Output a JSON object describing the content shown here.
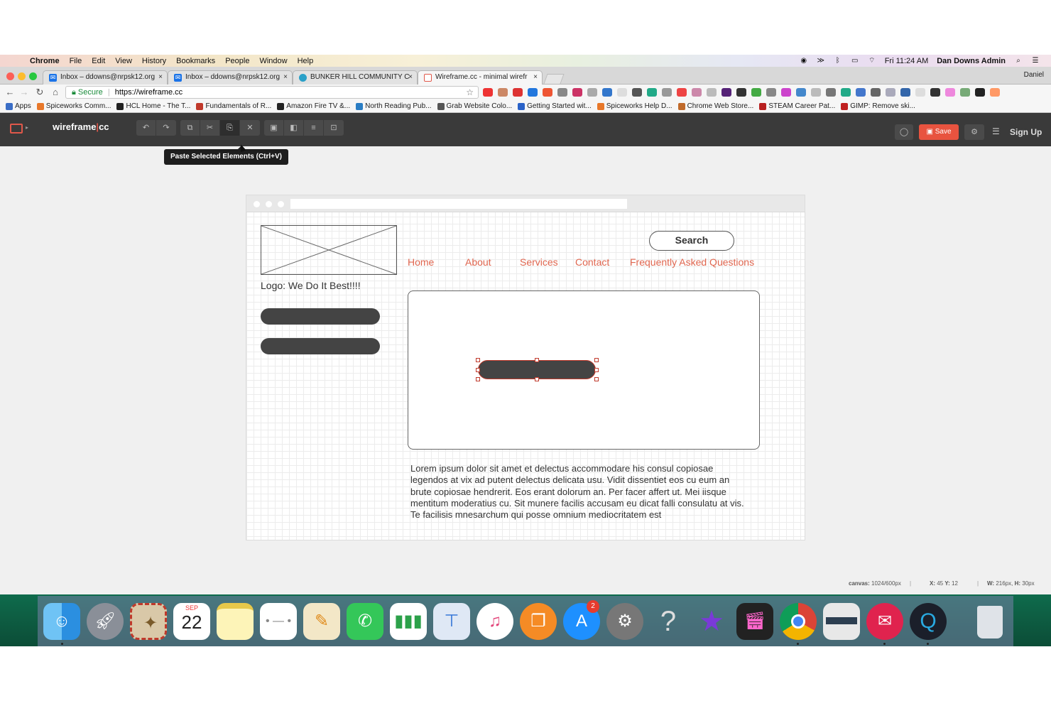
{
  "menubar": {
    "app": "Chrome",
    "items": [
      "File",
      "Edit",
      "View",
      "History",
      "Bookmarks",
      "People",
      "Window",
      "Help"
    ],
    "clock": "Fri 11:24 AM",
    "user": "Dan Downs Admin"
  },
  "tabs": [
    {
      "label": "Inbox – ddowns@nrpsk12.org",
      "active": false
    },
    {
      "label": "Inbox – ddowns@nrpsk12.org",
      "active": false
    },
    {
      "label": "BUNKER HILL COMMUNITY C",
      "active": false
    },
    {
      "label": "Wireframe.cc - minimal wirefr",
      "active": true
    }
  ],
  "profile_name": "Daniel",
  "address": {
    "secure_label": "Secure",
    "url": "https://wireframe.cc"
  },
  "bookmarks": [
    "Apps",
    "Spiceworks Comm...",
    "HCL Home - The T...",
    "Fundamentals of R...",
    "Amazon Fire TV &...",
    "North Reading Pub...",
    "Grab Website Colo...",
    "Getting Started wit...",
    "Spiceworks Help D...",
    "Chrome Web Store...",
    "STEAM Career Pat...",
    "GIMP: Remove ski..."
  ],
  "app": {
    "brand_left": "wireframe",
    "brand_right": "cc",
    "save_label": "Save",
    "signup_label": "Sign Up",
    "tooltip": "Paste Selected Elements (Ctrl+V)"
  },
  "wireframe": {
    "logo_text": "Logo: We Do It Best!!!!",
    "search_label": "Search",
    "nav": [
      "Home",
      "About",
      "Services",
      "Contact",
      "Frequently Asked Questions"
    ],
    "body_text": "Lorem ipsum dolor sit amet et delectus accommodare his consul copiosae legendos at vix ad putent delectus delicata usu. Vidit dissentiet eos cu eum an brute copiosae hendrerit. Eos erant dolorum an. Per facer affert ut. Mei iisque mentitum moderatius cu. Sit munere facilis accusam eu dicat falli consulatu at vis. Te facilisis mnesarchum qui posse omnium mediocritatem est"
  },
  "status": {
    "canvas_label": "canvas:",
    "canvas_value": "1024/600px",
    "x_label": "X:",
    "x_value": "45",
    "y_label": "Y:",
    "y_value": "12",
    "w_label": "W:",
    "w_value": "216px,",
    "h_label": "H:",
    "h_value": "30px"
  },
  "dock": {
    "calendar_month": "SEP",
    "calendar_day": "22",
    "appstore_badge": "2"
  },
  "colors": {
    "accent": "#e8533f",
    "nav_link": "#e0664f",
    "toolbar": "#3a3a3a"
  }
}
